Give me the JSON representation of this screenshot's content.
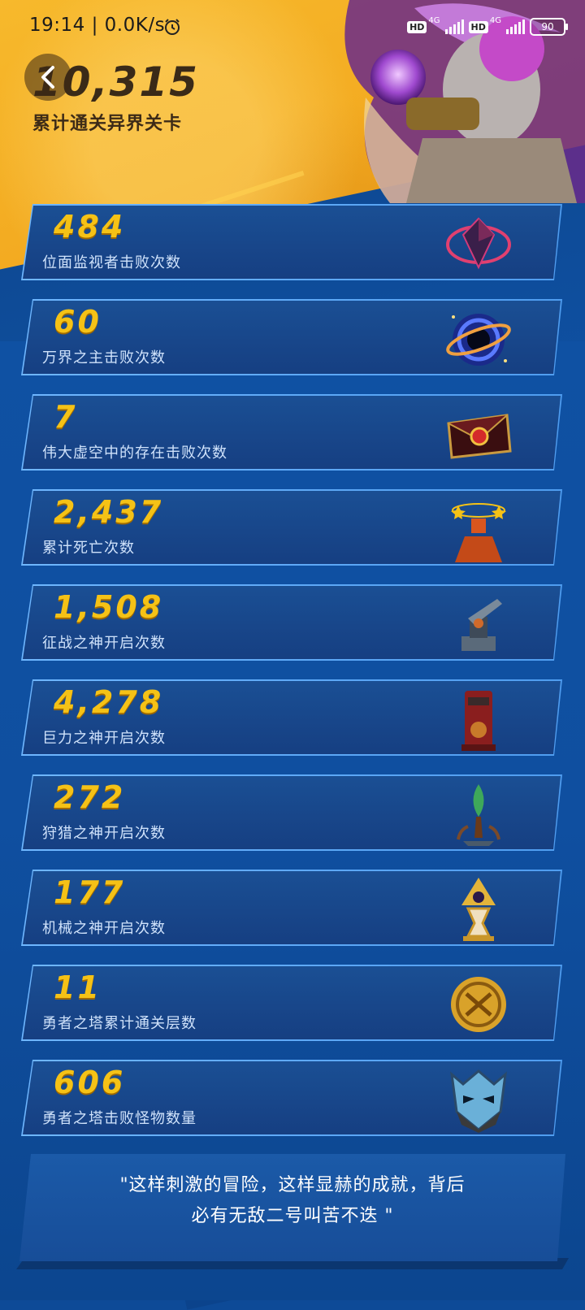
{
  "status_bar": {
    "time_speed": "19:14 | 0.0K/s",
    "hd_badge": "HD",
    "network": "4G",
    "battery": "90"
  },
  "header": {
    "total_value": "10,315",
    "total_label": "累计通关异界关卡"
  },
  "stats": [
    {
      "value": "484",
      "label": "位面监视者击败次数",
      "icon": "crystal-cube-icon"
    },
    {
      "value": "60",
      "label": "万界之主击败次数",
      "icon": "black-hole-icon"
    },
    {
      "value": "7",
      "label": "伟大虚空中的存在击败次数",
      "icon": "sealed-envelope-icon"
    },
    {
      "value": "2,437",
      "label": "累计死亡次数",
      "icon": "dizzy-dummy-icon"
    },
    {
      "value": "1,508",
      "label": "征战之神开启次数",
      "icon": "war-turret-icon"
    },
    {
      "value": "4,278",
      "label": "巨力之神开启次数",
      "icon": "power-tower-icon"
    },
    {
      "value": "272",
      "label": "狩猎之神开启次数",
      "icon": "hunting-plant-icon"
    },
    {
      "value": "177",
      "label": "机械之神开启次数",
      "icon": "mechanical-hourglass-icon"
    },
    {
      "value": "11",
      "label": "勇者之塔累计通关层数",
      "icon": "gold-medal-icon"
    },
    {
      "value": "606",
      "label": "勇者之塔击败怪物数量",
      "icon": "monster-mask-icon"
    }
  ],
  "quote": {
    "line1": "\"这样刺激的冒险，这样显赫的成就，背后",
    "line2": "必有无敌二号叫苦不迭 \""
  },
  "colors": {
    "accent_yellow": "#f5c216",
    "card_bg": "#163f82",
    "card_border": "#6fb7ff",
    "top_bg": "#f2a81f"
  }
}
